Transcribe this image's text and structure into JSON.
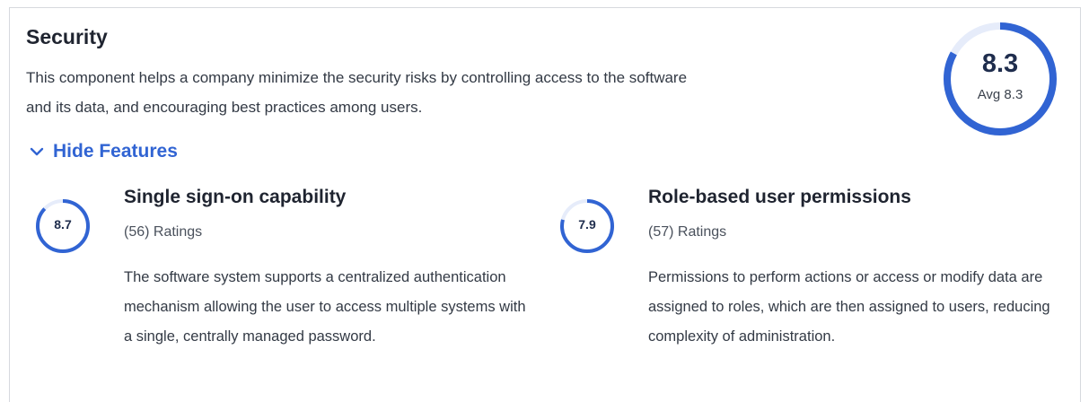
{
  "section": {
    "title": "Security",
    "description": "This component helps a company minimize the security risks by controlling access to the software and its data, and encouraging best practices among users.",
    "toggle_label": "Hide Features",
    "toggle_icon": "chevron-down-icon",
    "accent_color": "#3164d3",
    "average": {
      "score": "8.3",
      "label": "Avg 8.3",
      "score_value": 8.3
    }
  },
  "features": [
    {
      "name": "Single sign-on capability",
      "score": "8.7",
      "score_value": 8.7,
      "ratings": "(56) Ratings",
      "description": "The software system supports a centralized authentication mechanism allowing the user to access multiple systems with a single, centrally managed password."
    },
    {
      "name": "Role-based user permissions",
      "score": "7.9",
      "score_value": 7.9,
      "ratings": "(57) Ratings",
      "description": "Permissions to perform actions or access or modify data are assigned to roles, which are then assigned to users, reducing complexity of administration."
    }
  ]
}
